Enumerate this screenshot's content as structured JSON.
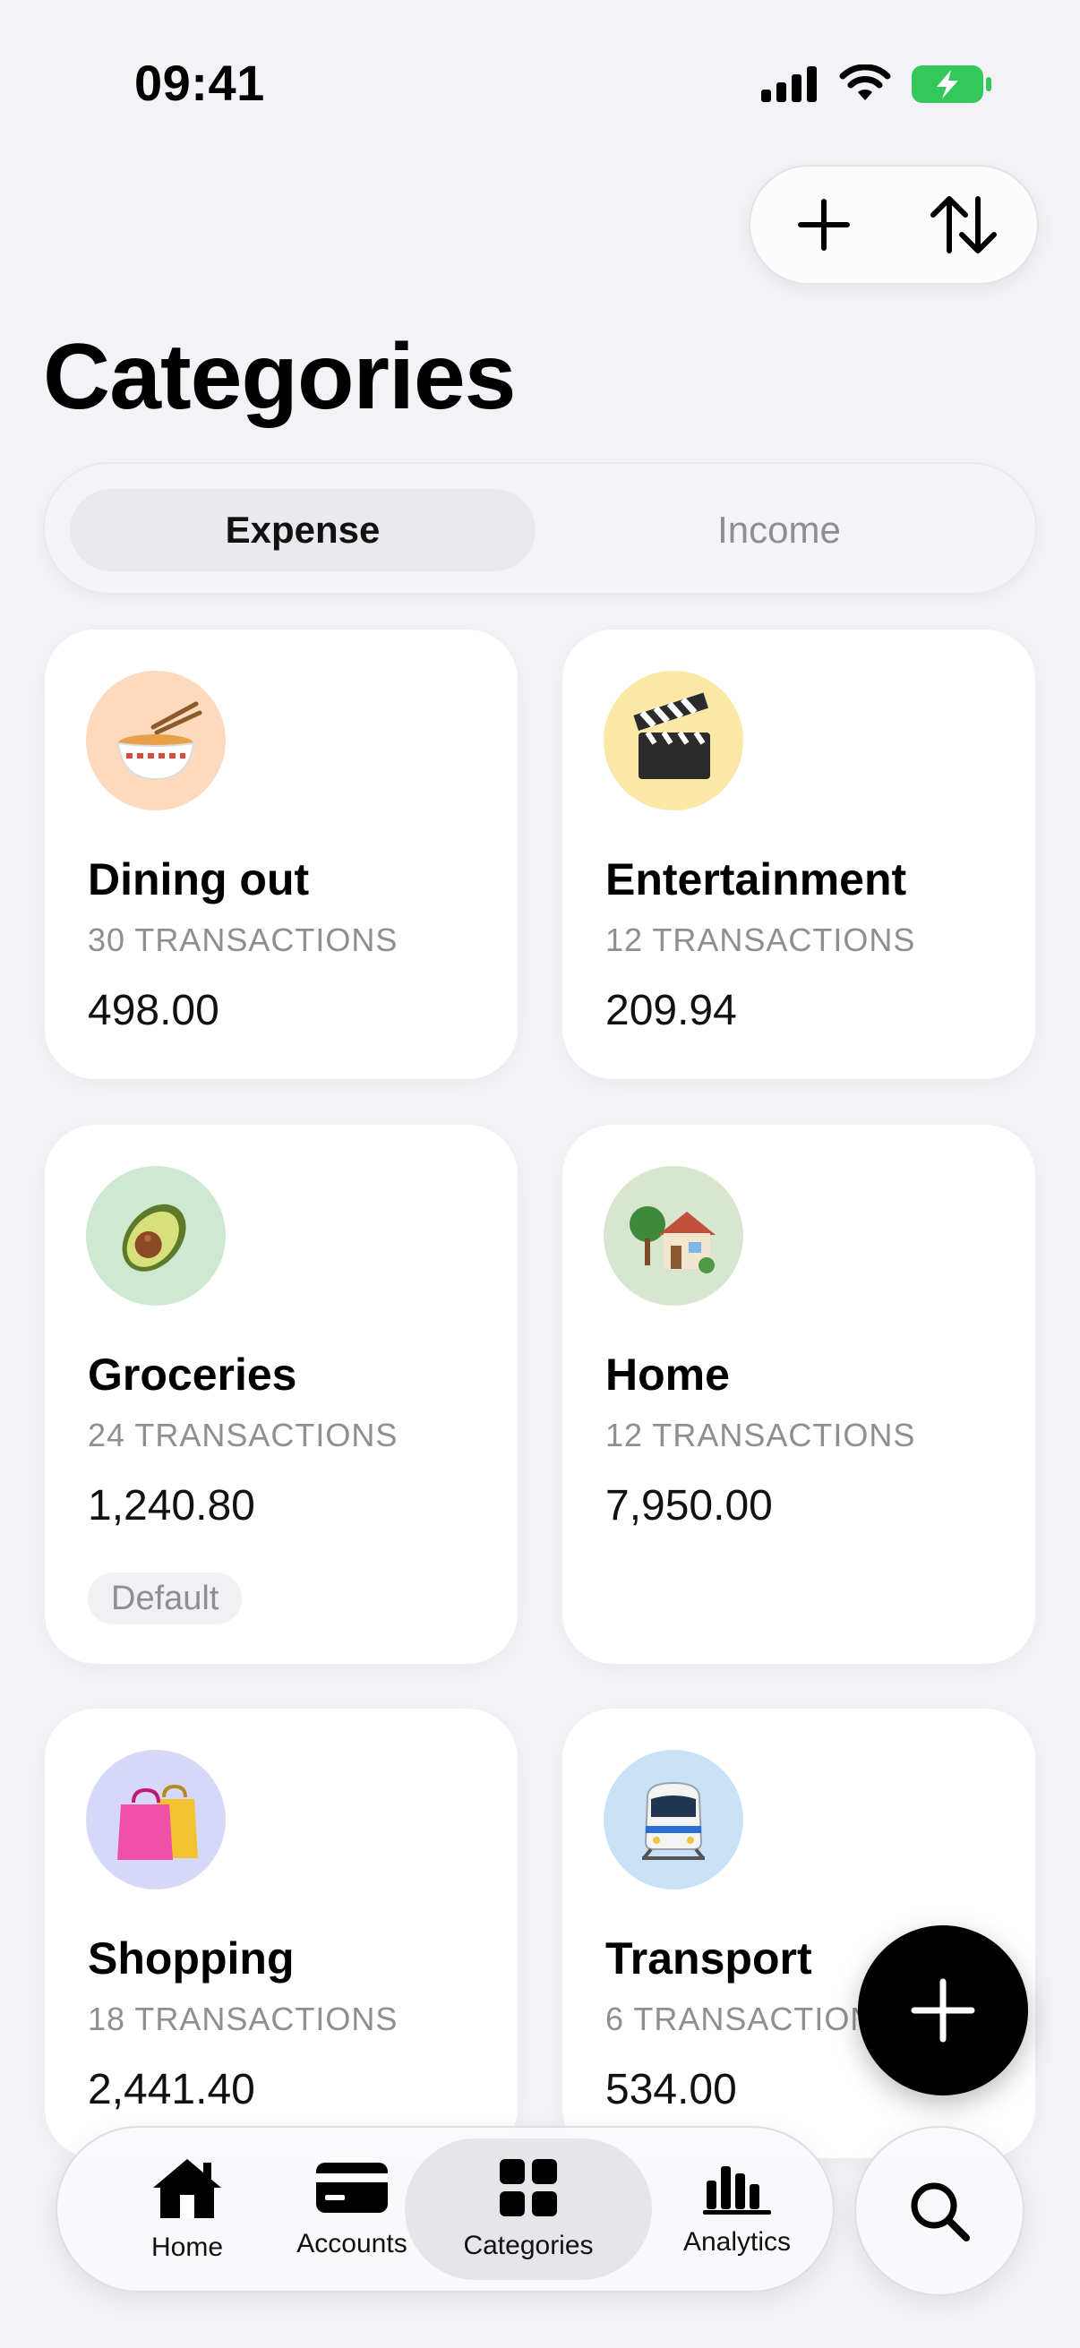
{
  "status_bar": {
    "time": "09:41",
    "icons": [
      "signal-icon",
      "wifi-icon",
      "battery-charging-icon"
    ],
    "battery_color": "#34c759"
  },
  "top_actions": {
    "icons": [
      "plus-icon",
      "sort-icon"
    ]
  },
  "page": {
    "title": "Categories"
  },
  "segments": {
    "expense": "Expense",
    "income": "Income",
    "selected": "expense"
  },
  "categories": [
    {
      "name": "Dining out",
      "count": "30 TRANSACTIONS",
      "amount": "498.00",
      "icon": "noodle-bowl-icon",
      "color": "#fdd9bd"
    },
    {
      "name": "Entertainment",
      "count": "12 TRANSACTIONS",
      "amount": "209.94",
      "icon": "clapper-board-icon",
      "color": "#fbe7a6"
    },
    {
      "name": "Groceries",
      "count": "24 TRANSACTIONS",
      "amount": "1,240.80",
      "icon": "avocado-icon",
      "color": "#cfe8d2",
      "badge": "Default"
    },
    {
      "name": "Home",
      "count": "12 TRANSACTIONS",
      "amount": "7,950.00",
      "icon": "house-icon",
      "color": "#d9e6cf"
    },
    {
      "name": "Shopping",
      "count": "18 TRANSACTIONS",
      "amount": "2,441.40",
      "icon": "shopping-bags-icon",
      "color": "#d6d8f7"
    },
    {
      "name": "Transport",
      "count": "6 TRANSACTIONS",
      "amount": "534.00",
      "icon": "train-icon",
      "color": "#c9e2f5"
    }
  ],
  "fab": {
    "icon": "plus-icon"
  },
  "tab_bar": {
    "tabs": [
      {
        "label": "Home",
        "icon": "home-icon"
      },
      {
        "label": "Accounts",
        "icon": "card-icon"
      },
      {
        "label": "Categories",
        "icon": "grid-icon",
        "active": true
      },
      {
        "label": "Analytics",
        "icon": "bar-chart-icon"
      }
    ],
    "search_icon": "search-icon"
  }
}
